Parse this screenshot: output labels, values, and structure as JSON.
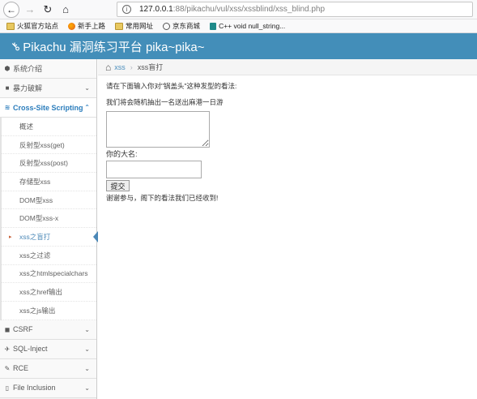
{
  "browser": {
    "url_host": "127.0.0.1",
    "url_path": ":88/pikachu/vul/xss/xssblind/xss_blind.php"
  },
  "bookmarks": [
    {
      "label": "火狐官方站点",
      "icon": "folder-icon"
    },
    {
      "label": "新手上路",
      "icon": "firefox-icon"
    },
    {
      "label": "常用网址",
      "icon": "folder-icon"
    },
    {
      "label": "京东商城",
      "icon": "globe-icon"
    },
    {
      "label": "C++ void null_string...",
      "icon": "bing-icon"
    }
  ],
  "header": {
    "title": "Pikachu 漏洞练习平台 pika~pika~"
  },
  "sidebar": {
    "items": [
      {
        "label": "系统介绍",
        "icon": "tags-icon"
      },
      {
        "label": "暴力破解",
        "icon": "lock-icon"
      },
      {
        "label": "Cross-Site Scripting",
        "icon": "code-icon"
      },
      {
        "label": "CSRF",
        "icon": "cube-icon"
      },
      {
        "label": "SQL-Inject",
        "icon": "plane-icon"
      },
      {
        "label": "RCE",
        "icon": "pencil-icon"
      },
      {
        "label": "File Inclusion",
        "icon": "file-icon"
      }
    ],
    "xss_sub": [
      "概述",
      "反射型xss(get)",
      "反射型xss(post)",
      "存储型xss",
      "DOM型xss",
      "DOM型xss-x",
      "xss之盲打",
      "xss之过滤",
      "xss之htmlspecialchars",
      "xss之href输出",
      "xss之js输出"
    ]
  },
  "breadcrumb": {
    "link": "xss",
    "current": "xss盲打"
  },
  "main": {
    "line1": "请在下面输入你对\"锅盖头\"这种发型的看法:",
    "line2": "我们将会随机抽出一名送出麻港一日游",
    "name_label": "你的大名:",
    "submit_label": "提交",
    "thanks": "谢谢参与，阁下的看法我们已经收到!"
  }
}
